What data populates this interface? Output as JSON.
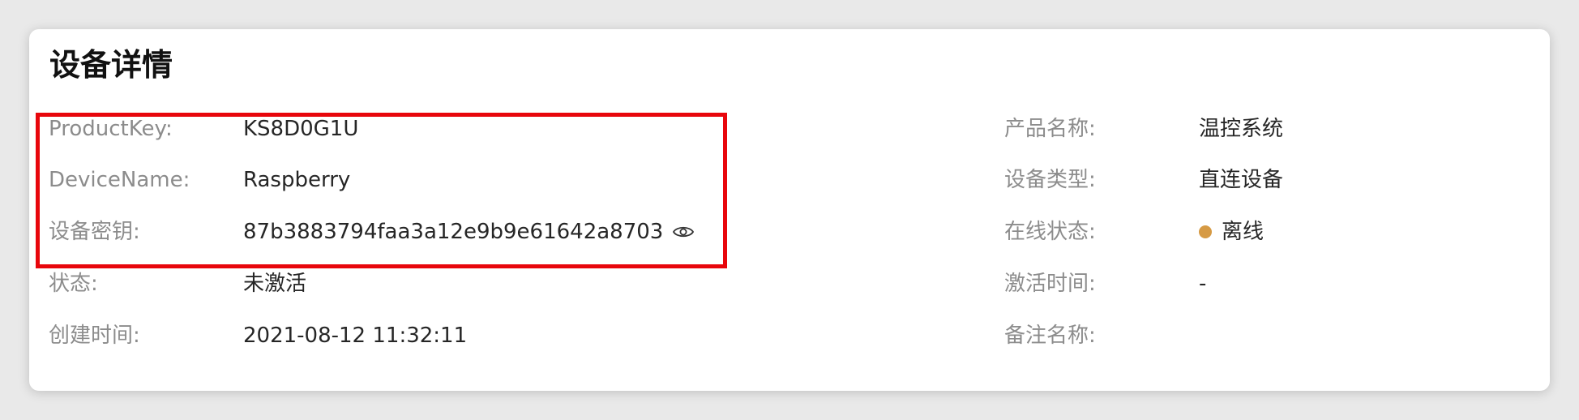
{
  "card": {
    "title": "设备详情"
  },
  "left_fields": [
    {
      "label": "ProductKey:",
      "value": "KS8D0G1U"
    },
    {
      "label": "DeviceName:",
      "value": "Raspberry"
    },
    {
      "label": "设备密钥:",
      "value": "87b3883794faa3a12e9b9e61642a8703",
      "icon": "eye-icon"
    },
    {
      "label": "状态:",
      "value": "未激活"
    },
    {
      "label": "创建时间:",
      "value": "2021-08-12 11:32:11"
    }
  ],
  "right_fields": [
    {
      "label": "产品名称:",
      "value": "温控系统"
    },
    {
      "label": "设备类型:",
      "value": "直连设备"
    },
    {
      "label": "在线状态:",
      "value": "离线",
      "status_color": "#d69a44"
    },
    {
      "label": "激活时间:",
      "value": "-"
    },
    {
      "label": "备注名称:",
      "value": ""
    }
  ],
  "colors": {
    "highlight_border": "#e8060c",
    "label": "#8c8c8c",
    "value": "#262626",
    "offline_dot": "#d69a44"
  }
}
